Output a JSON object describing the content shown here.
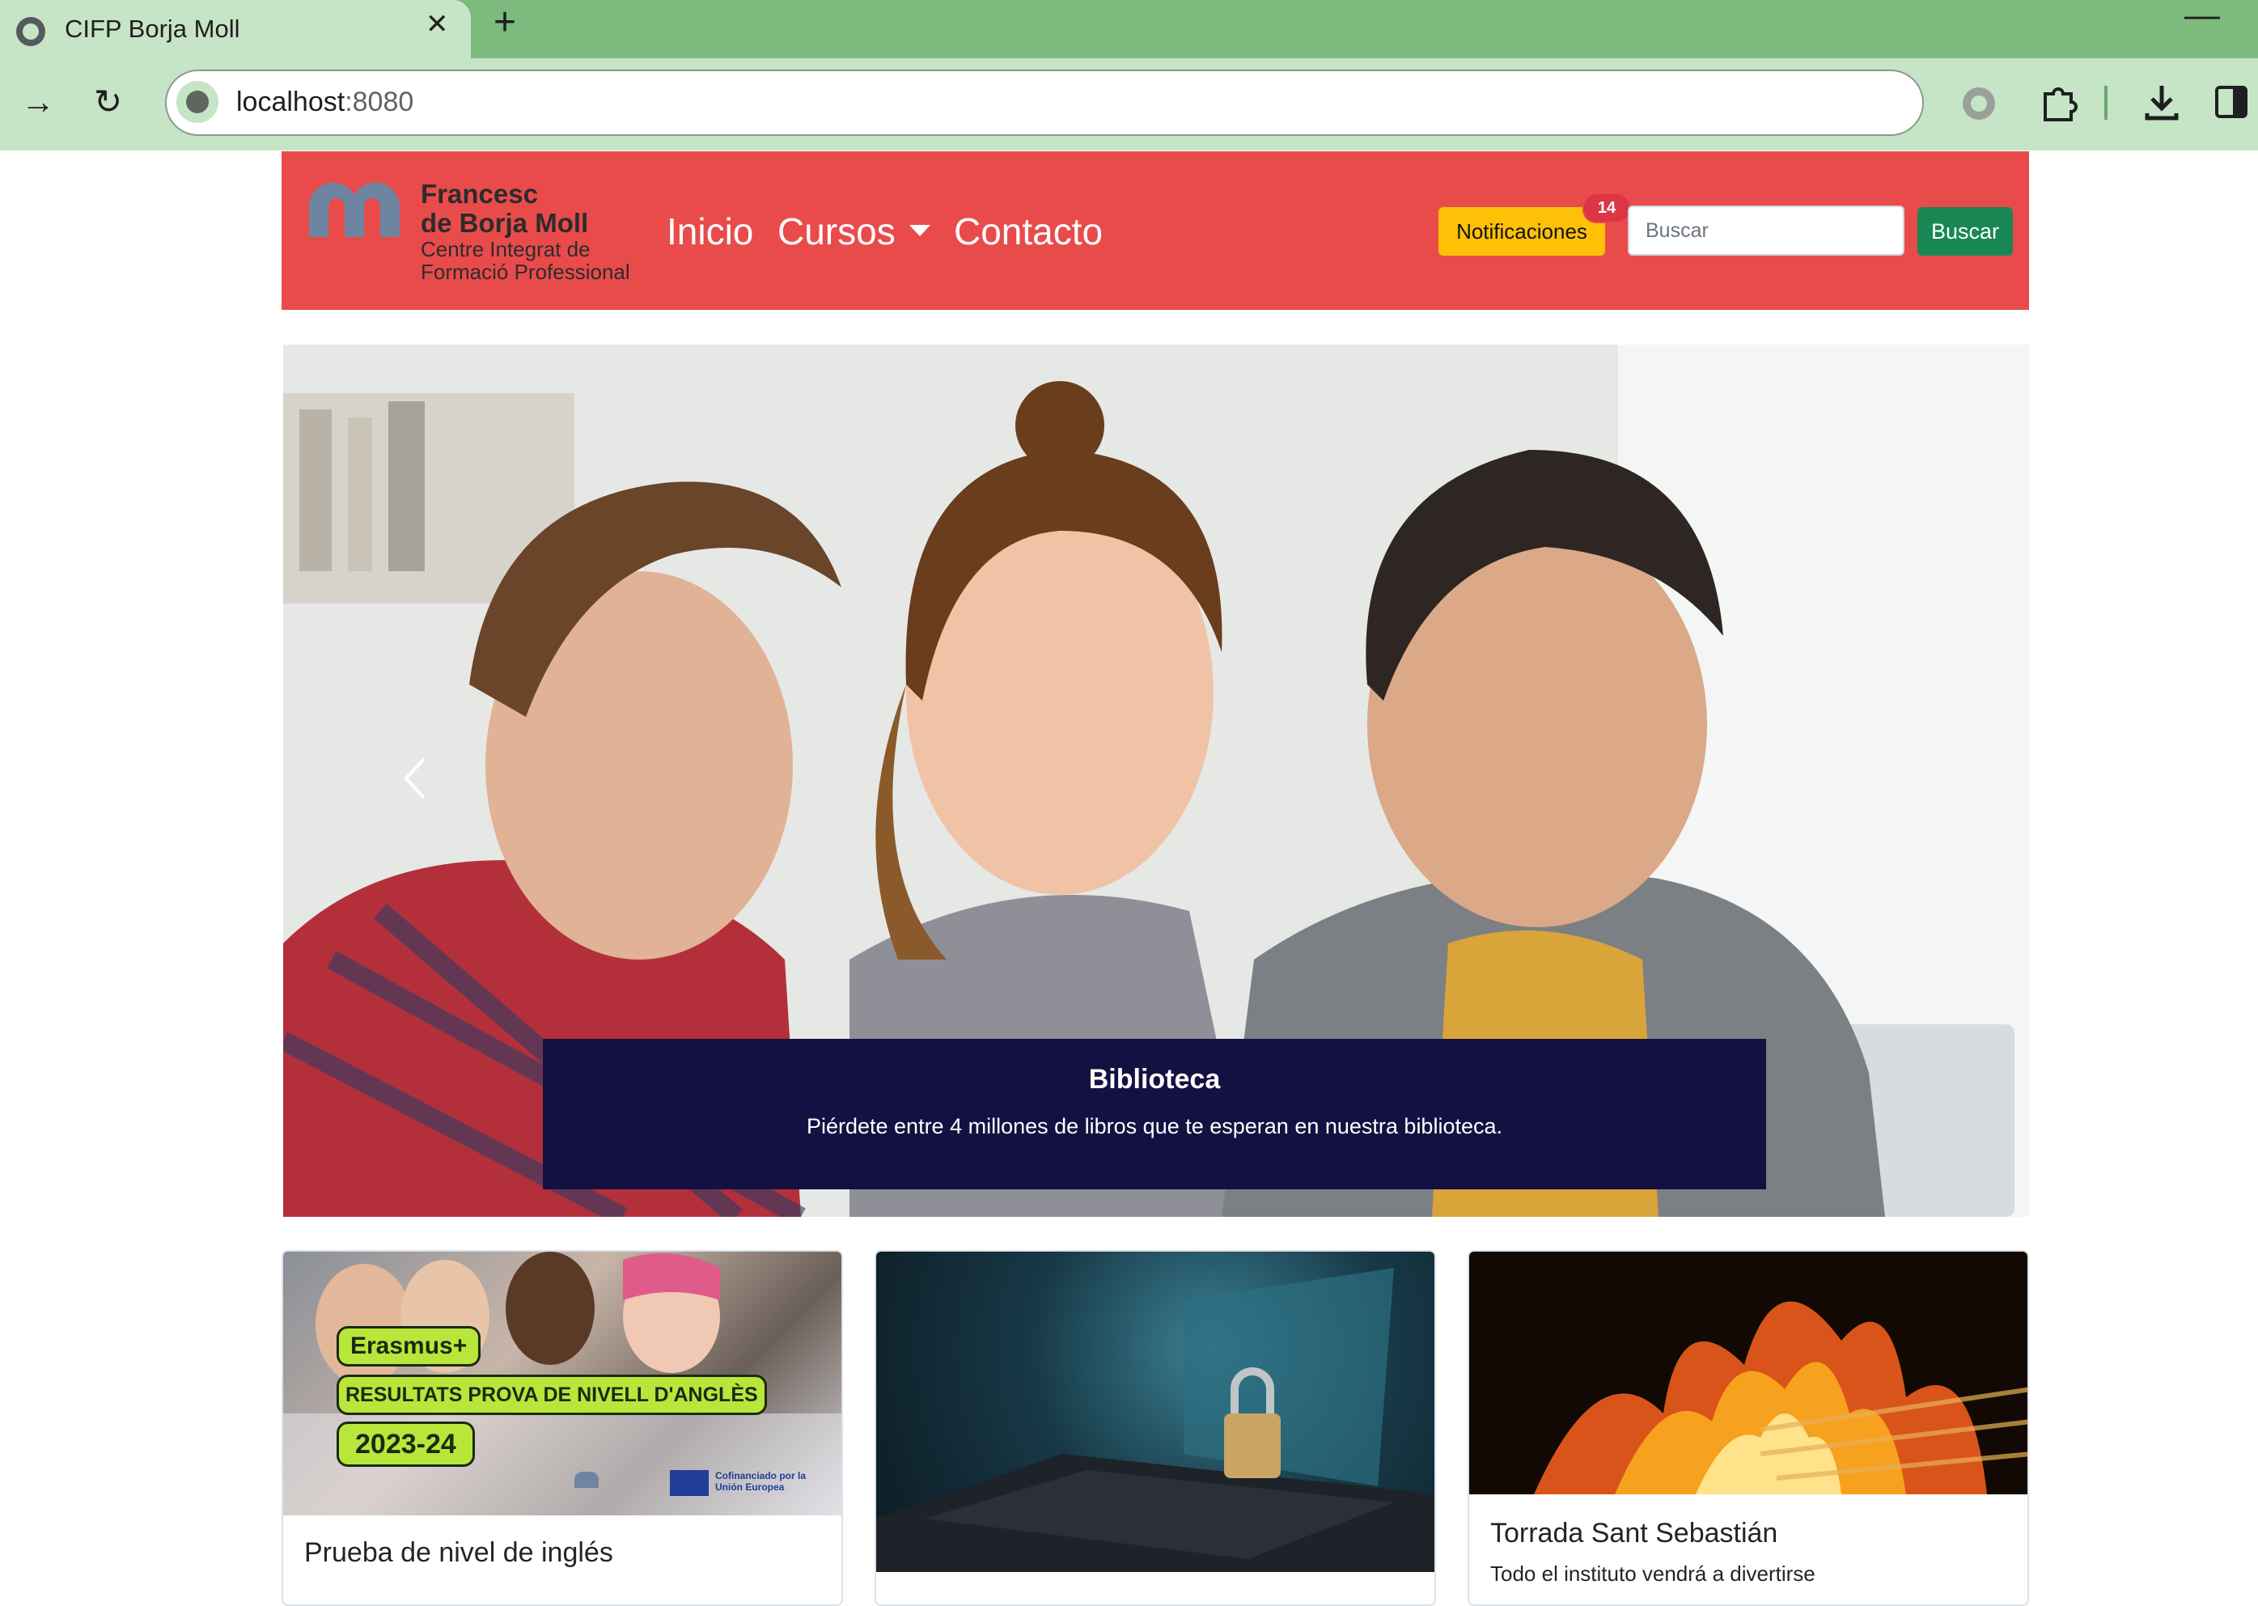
{
  "browser": {
    "tab_title": "CIFP Borja Moll",
    "url_host": "localhost",
    "url_port": ":8080"
  },
  "header": {
    "logo": {
      "name_line1": "Francesc",
      "name_line2": "de Borja Moll",
      "sub_line1": "Centre Integrat de",
      "sub_line2": "Formació Professional"
    },
    "nav": {
      "home": "Inicio",
      "courses": "Cursos",
      "contact": "Contacto"
    },
    "notifications_label": "Notificaciones",
    "notifications_count": "14",
    "search_placeholder": "Buscar",
    "search_button": "Buscar"
  },
  "carousel": {
    "caption_title": "Biblioteca",
    "caption_text": "Piérdete entre 4 millones de libros que te esperan en nuestra biblioteca."
  },
  "cards": [
    {
      "title": "Prueba de nivel de inglés",
      "image_text": {
        "badge": "Erasmus+",
        "headline": "RESULTATS PROVA DE NIVELL D'ANGLÈS",
        "year": "2023-24",
        "eu_note": "Cofinanciado por la Unión Europea"
      }
    },
    {
      "title": "",
      "text": ""
    },
    {
      "title": "Torrada Sant Sebastián",
      "text": "Todo el instituto vendrá a divertirse"
    }
  ],
  "colors": {
    "header_red": "#e94b4b",
    "notif_yellow": "#ffc107",
    "search_green": "#198754",
    "caption_navy": "#141142",
    "chrome_green": "#7cba7d"
  }
}
